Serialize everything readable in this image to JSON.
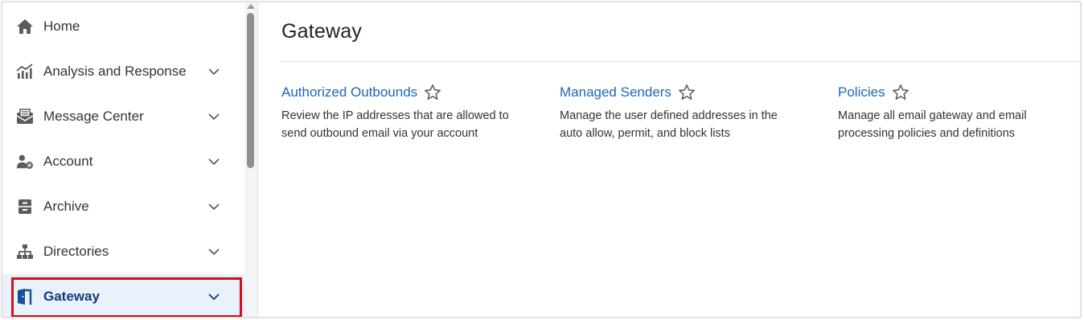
{
  "sidebar": {
    "items": [
      {
        "label": "Home",
        "icon": "home-icon",
        "has_chevron": false
      },
      {
        "label": "Analysis and Response",
        "icon": "analysis-chart-icon",
        "has_chevron": true
      },
      {
        "label": "Message Center",
        "icon": "message-center-icon",
        "has_chevron": true
      },
      {
        "label": "Account",
        "icon": "account-gear-icon",
        "has_chevron": true
      },
      {
        "label": "Archive",
        "icon": "archive-icon",
        "has_chevron": true
      },
      {
        "label": "Directories",
        "icon": "directories-icon",
        "has_chevron": true
      },
      {
        "label": "Gateway",
        "icon": "gateway-door-icon",
        "has_chevron": true,
        "active": true
      }
    ]
  },
  "main": {
    "title": "Gateway",
    "cards": [
      {
        "title": "Authorized Outbounds",
        "description": "Review the IP addresses that are allowed to send outbound email via your account",
        "starred": false
      },
      {
        "title": "Managed Senders",
        "description": "Manage the user defined addresses in the auto allow, permit, and block lists",
        "starred": false
      },
      {
        "title": "Policies",
        "description": "Manage all email gateway and email processing policies and definitions",
        "starred": false
      }
    ]
  },
  "colors": {
    "link": "#1f66b6",
    "active_bg": "#e9f1fb",
    "active_text": "#0f3c78",
    "highlight": "#d0101b",
    "icon": "#5b5b5b",
    "active_icon": "#1b4f9c"
  }
}
